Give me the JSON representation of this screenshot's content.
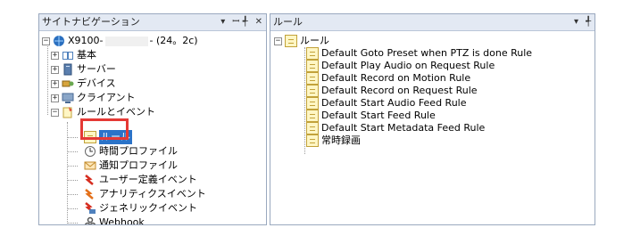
{
  "left_pane": {
    "title": "サイトナビゲーション",
    "pin_label": "ꟷ ╃",
    "close_label": "✕",
    "dropdown_label": "▾",
    "root": {
      "prefix": "X9100-",
      "suffix": "- (24。2c)"
    },
    "items": [
      {
        "label": "基本",
        "icon": "book-icon"
      },
      {
        "label": "サーバー",
        "icon": "server-icon"
      },
      {
        "label": "デバイス",
        "icon": "device-icon"
      },
      {
        "label": "クライアント",
        "icon": "client-icon"
      },
      {
        "label": "ルールとイベント",
        "icon": "rules-events-icon"
      }
    ],
    "children": [
      {
        "label": "ルール",
        "icon": "rule-icon"
      },
      {
        "label": "時間プロファイル",
        "icon": "time-profile-icon"
      },
      {
        "label": "通知プロファイル",
        "icon": "notification-icon"
      },
      {
        "label": "ユーザー定義イベント",
        "icon": "user-event-icon"
      },
      {
        "label": "アナリティクスイベント",
        "icon": "analytics-event-icon"
      },
      {
        "label": "ジェネリックイベント",
        "icon": "generic-event-icon"
      },
      {
        "label": "Webhook",
        "icon": "webhook-icon"
      }
    ]
  },
  "right_pane": {
    "title": "ルール",
    "dropdown_label": "▾",
    "pin_label": "╃",
    "root_label": "ルール",
    "rules": [
      "Default Goto Preset when PTZ is done Rule",
      "Default Play Audio on Request Rule",
      "Default Record on Motion Rule",
      "Default Record on Request Rule",
      "Default Start Audio Feed Rule",
      "Default Start Feed Rule",
      "Default Start Metadata Feed Rule",
      "常時録画"
    ]
  },
  "colors": {
    "highlight": "#e53935",
    "selection": "#2b73c8",
    "titlebar": "#e3e9f3"
  }
}
